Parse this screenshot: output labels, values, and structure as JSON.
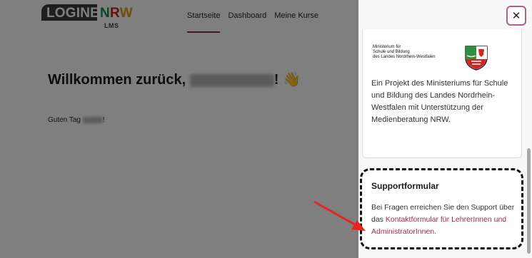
{
  "navbar": {
    "logo_main": "LOGINEO",
    "logo_n": "N",
    "logo_r": "R",
    "logo_w": "W",
    "logo_sub": "LMS",
    "links": [
      "Startseite",
      "Dashboard",
      "Meine Kurse"
    ],
    "active_link": "Startseite"
  },
  "main": {
    "welcome_prefix": "Willkommen zurück,",
    "welcome_suffix": "! 👋",
    "greeting_prefix": "Guten Tag",
    "greeting_suffix": "!"
  },
  "drawer": {
    "close_label": "✕",
    "ministry_lines": [
      "Ministerium für",
      "Schule und Bildung",
      "des Landes Nordrhein-Westfalen"
    ],
    "project_text": "Ein Projekt des Ministeriums für Schule und Bildung des Landes Nordrhein-Westfalen mit Unterstützung der Medienberatung NRW.",
    "support": {
      "title": "Supportformular",
      "text_prefix": "Bei Fragen erreichen Sie den Support über das",
      "link_text": "Kontaktformular für LehrerInnen und AdministratorInnen."
    }
  },
  "colors": {
    "accent": "#9b2a5a",
    "annotation_arrow": "#e8231f"
  }
}
